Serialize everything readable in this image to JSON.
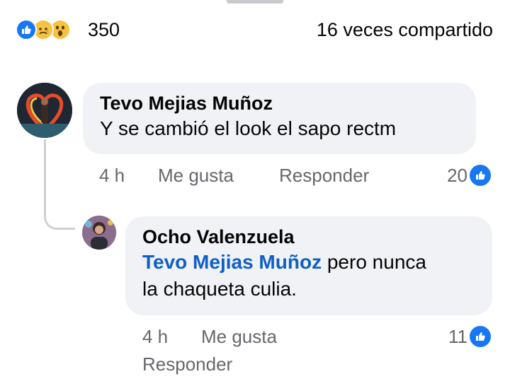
{
  "reactions": {
    "icons": [
      "like-icon",
      "sad-icon",
      "wow-icon"
    ],
    "count": "350",
    "shares": "16 veces compartido"
  },
  "comments": [
    {
      "author": "Tevo Mejias Muñoz",
      "text": "Y se cambió el look el sapo rectm",
      "time": "4 h",
      "like_label": "Me gusta",
      "reply_label": "Responder",
      "likes": "20"
    }
  ],
  "replies": [
    {
      "author": "Ocho Valenzuela",
      "mention": "Tevo Mejias Muñoz",
      "text_line1": "pero nunca",
      "text_line2": "la chaqueta culia.",
      "time": "4 h",
      "like_label": "Me gusta",
      "reply_label": "Responder",
      "likes": "11"
    }
  ],
  "colors": {
    "accent": "#1877f2",
    "bubble": "#f0f2f5",
    "meta": "#65676b",
    "mention": "#0f5fc7"
  }
}
